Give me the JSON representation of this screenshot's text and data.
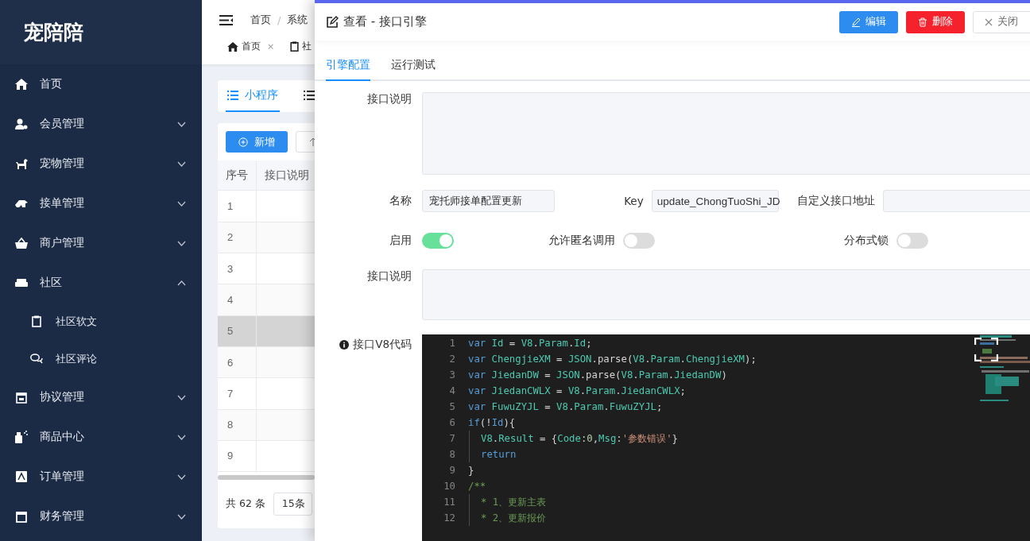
{
  "sidebar": {
    "logo": "宠陪陪",
    "items": [
      {
        "kind": "item",
        "label": "首页"
      },
      {
        "kind": "group",
        "label": "会员管理",
        "expanded": false
      },
      {
        "kind": "group",
        "label": "宠物管理",
        "expanded": false
      },
      {
        "kind": "group",
        "label": "接单管理",
        "expanded": false
      },
      {
        "kind": "group",
        "label": "商户管理",
        "expanded": false
      },
      {
        "kind": "group",
        "label": "社区",
        "expanded": true,
        "children": [
          {
            "label": "社区软文"
          },
          {
            "label": "社区评论"
          }
        ]
      },
      {
        "kind": "group",
        "label": "协议管理",
        "expanded": false
      },
      {
        "kind": "group",
        "label": "商品中心",
        "expanded": false
      },
      {
        "kind": "group",
        "label": "订单管理",
        "expanded": false
      },
      {
        "kind": "group",
        "label": "财务管理",
        "expanded": false
      }
    ]
  },
  "background_page": {
    "breadcrumb": [
      "首页",
      "系统"
    ],
    "separator": "/",
    "tags": [
      {
        "label": "首页",
        "close": "×"
      },
      {
        "label": "社"
      }
    ],
    "card_tabs": [
      {
        "label": "小程序",
        "selected": true
      },
      {
        "selected": false
      }
    ],
    "add_button": "新增",
    "table": {
      "columns": [
        "序号",
        "接口说明"
      ],
      "rows": [
        {
          "index": "1",
          "selected": false
        },
        {
          "index": "2",
          "selected": false
        },
        {
          "index": "3",
          "selected": false
        },
        {
          "index": "4",
          "selected": false
        },
        {
          "index": "5",
          "selected": true
        },
        {
          "index": "6",
          "selected": false
        },
        {
          "index": "7",
          "selected": false
        },
        {
          "index": "8",
          "selected": false
        },
        {
          "index": "9",
          "selected": false
        }
      ]
    },
    "pagination": {
      "total": "共 62 条",
      "page_size": "15条"
    }
  },
  "drawer": {
    "title": "查看 - 接口引擎",
    "buttons": [
      {
        "kind": "edit",
        "label": "编辑"
      },
      {
        "kind": "delete",
        "label": "删除"
      },
      {
        "kind": "close",
        "label": "关闭"
      }
    ],
    "tabs": [
      {
        "label": "引擎配置",
        "selected": true
      },
      {
        "label": "运行测试",
        "selected": false
      }
    ],
    "form": {
      "description_top": {
        "label": "接口说明"
      },
      "name": {
        "label": "名称",
        "value": "宠托师接单配置更新"
      },
      "key": {
        "label": "Key",
        "value": "update_ChongTuoShi_JD"
      },
      "custom_url": {
        "label": "自定义接口地址"
      },
      "switches": [
        {
          "label": "启用",
          "on": true
        },
        {
          "label": "允许匿名调用",
          "on": false
        },
        {
          "label": "分布式锁",
          "on": false
        }
      ],
      "description": {
        "label": "接口说明"
      },
      "code": {
        "label": "接口V8代码",
        "lines": [
          {
            "number": "1",
            "indented": false,
            "tokens": [
              {
                "kind": "keyword",
                "text": "var"
              },
              {
                "kind": "identifier",
                "text": " Id"
              },
              {
                "kind": "plain",
                "text": " = "
              },
              {
                "kind": "identifier",
                "text": "V8"
              },
              {
                "kind": "plain",
                "text": "."
              },
              {
                "kind": "identifier",
                "text": "Param"
              },
              {
                "kind": "plain",
                "text": "."
              },
              {
                "kind": "identifier",
                "text": "Id"
              },
              {
                "kind": "plain",
                "text": ";"
              }
            ]
          },
          {
            "number": "2",
            "indented": false,
            "tokens": [
              {
                "kind": "keyword",
                "text": "var"
              },
              {
                "kind": "identifier",
                "text": " ChengjieXM"
              },
              {
                "kind": "plain",
                "text": " = "
              },
              {
                "kind": "identifier",
                "text": "JSON"
              },
              {
                "kind": "plain",
                "text": ".parse("
              },
              {
                "kind": "identifier",
                "text": "V8"
              },
              {
                "kind": "plain",
                "text": "."
              },
              {
                "kind": "identifier",
                "text": "Param"
              },
              {
                "kind": "plain",
                "text": "."
              },
              {
                "kind": "identifier",
                "text": "ChengjieXM"
              },
              {
                "kind": "plain",
                "text": ");"
              }
            ]
          },
          {
            "number": "3",
            "indented": false,
            "tokens": [
              {
                "kind": "keyword",
                "text": "var"
              },
              {
                "kind": "identifier",
                "text": " JiedanDW"
              },
              {
                "kind": "plain",
                "text": " = "
              },
              {
                "kind": "identifier",
                "text": "JSON"
              },
              {
                "kind": "plain",
                "text": ".parse("
              },
              {
                "kind": "identifier",
                "text": "V8"
              },
              {
                "kind": "plain",
                "text": "."
              },
              {
                "kind": "identifier",
                "text": "Param"
              },
              {
                "kind": "plain",
                "text": "."
              },
              {
                "kind": "identifier",
                "text": "JiedanDW"
              },
              {
                "kind": "plain",
                "text": ")"
              }
            ]
          },
          {
            "number": "4",
            "indented": false,
            "tokens": [
              {
                "kind": "keyword",
                "text": "var"
              },
              {
                "kind": "identifier",
                "text": " JiedanCWLX"
              },
              {
                "kind": "plain",
                "text": " = "
              },
              {
                "kind": "identifier",
                "text": "V8"
              },
              {
                "kind": "plain",
                "text": "."
              },
              {
                "kind": "identifier",
                "text": "Param"
              },
              {
                "kind": "plain",
                "text": "."
              },
              {
                "kind": "identifier",
                "text": "JiedanCWLX"
              },
              {
                "kind": "plain",
                "text": ";"
              }
            ]
          },
          {
            "number": "5",
            "indented": false,
            "tokens": [
              {
                "kind": "keyword",
                "text": "var"
              },
              {
                "kind": "identifier",
                "text": " FuwuZYJL"
              },
              {
                "kind": "plain",
                "text": " = "
              },
              {
                "kind": "identifier",
                "text": "V8"
              },
              {
                "kind": "plain",
                "text": "."
              },
              {
                "kind": "identifier",
                "text": "Param"
              },
              {
                "kind": "plain",
                "text": "."
              },
              {
                "kind": "identifier",
                "text": "FuwuZYJL"
              },
              {
                "kind": "plain",
                "text": ";"
              }
            ]
          },
          {
            "number": "6",
            "indented": false,
            "tokens": [
              {
                "kind": "keyword",
                "text": "if"
              },
              {
                "kind": "plain",
                "text": "(!"
              },
              {
                "kind": "keyword",
                "text": "Id"
              },
              {
                "kind": "plain",
                "text": "){"
              }
            ]
          },
          {
            "number": "7",
            "indented": true,
            "tokens": [
              {
                "kind": "identifier",
                "text": "V8"
              },
              {
                "kind": "plain",
                "text": "."
              },
              {
                "kind": "identifier",
                "text": "Result"
              },
              {
                "kind": "plain",
                "text": " = {"
              },
              {
                "kind": "identifier",
                "text": "Code"
              },
              {
                "kind": "plain",
                "text": ":"
              },
              {
                "kind": "number",
                "text": "0"
              },
              {
                "kind": "plain",
                "text": ","
              },
              {
                "kind": "identifier",
                "text": "Msg"
              },
              {
                "kind": "plain",
                "text": ":"
              },
              {
                "kind": "string",
                "text": "'参数错误'"
              },
              {
                "kind": "plain",
                "text": "}"
              }
            ]
          },
          {
            "number": "8",
            "indented": true,
            "tokens": [
              {
                "kind": "keyword",
                "text": "return"
              }
            ]
          },
          {
            "number": "9",
            "indented": false,
            "tokens": [
              {
                "kind": "plain",
                "text": "}"
              }
            ]
          },
          {
            "number": "10",
            "indented": false,
            "tokens": [
              {
                "kind": "comment",
                "text": "/**"
              }
            ]
          },
          {
            "number": "11",
            "indented": true,
            "tokens": [
              {
                "kind": "comment",
                "text": "* 1、更新主表"
              }
            ]
          },
          {
            "number": "12",
            "indented": true,
            "tokens": [
              {
                "kind": "comment",
                "text": "* 2、更新报价"
              }
            ]
          }
        ]
      }
    }
  }
}
